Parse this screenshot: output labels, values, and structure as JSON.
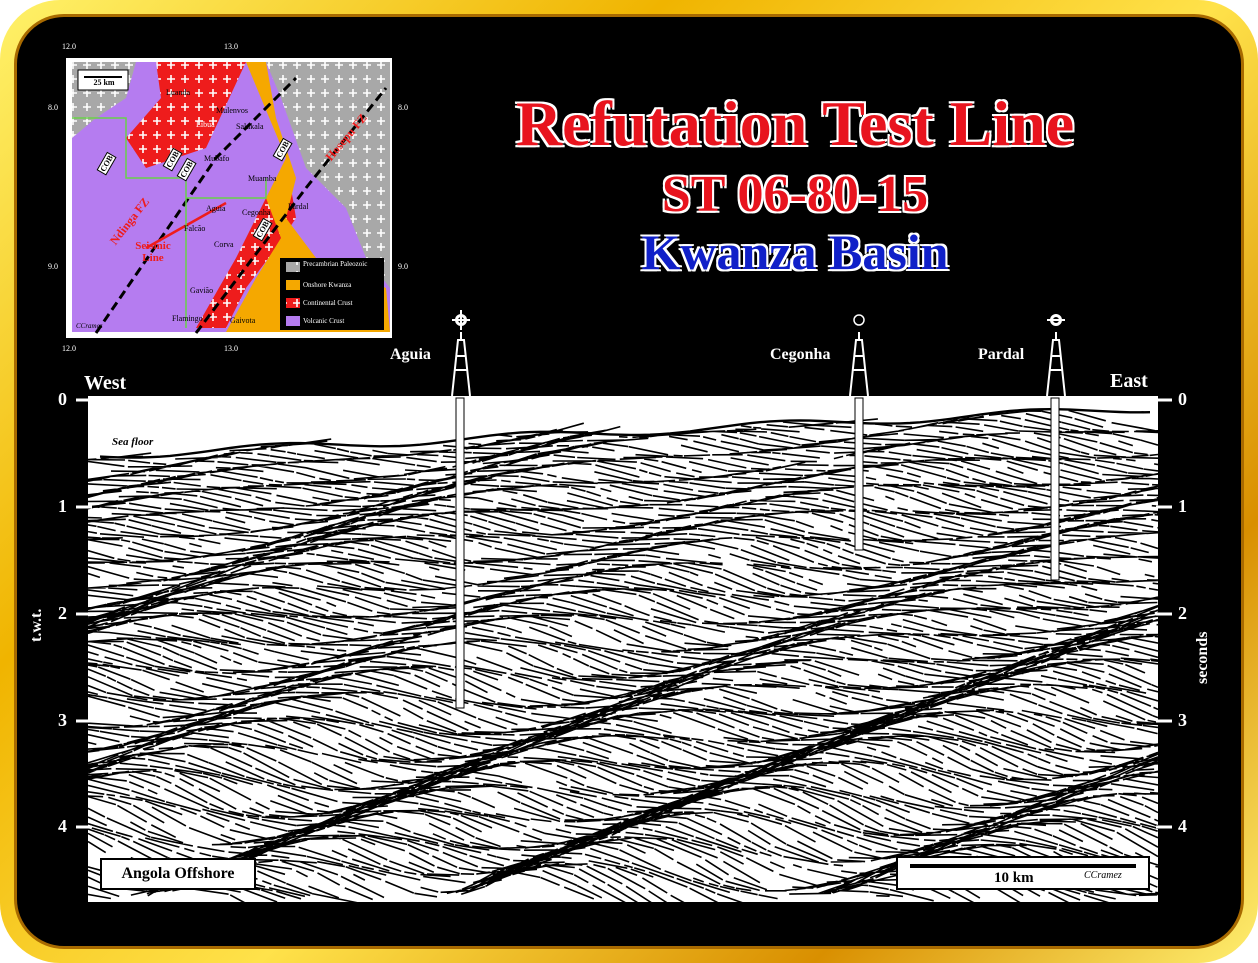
{
  "title": "Refutation Test Line",
  "line_id": "ST 06-80-15",
  "basin": "Kwanza Basin",
  "section": {
    "west": "West",
    "east": "East",
    "sea_floor": "Sea floor",
    "left_axis_label": "t.w.t.",
    "right_axis_label": "seconds",
    "ticks": [
      "0",
      "1",
      "2",
      "3",
      "4"
    ],
    "location_label": "Angola Offshore",
    "scale_label": "10 km",
    "credit": "CCramez"
  },
  "wells": [
    {
      "name": "Aguia"
    },
    {
      "name": "Cegonha"
    },
    {
      "name": "Pardal"
    }
  ],
  "map": {
    "scale": "25 km",
    "lon_ticks": [
      "12.0",
      "13.0"
    ],
    "lat_ticks": [
      "8.0",
      "9.0"
    ],
    "place_names": [
      "Luanda",
      "Mulenvos",
      "Libua",
      "Salukala",
      "Mubafo",
      "Muamba",
      "Aguia",
      "Cegonha",
      "Pardal",
      "Falcão",
      "Corva",
      "Gavião",
      "Flamingo",
      "Gaivota"
    ],
    "cob_label": "COB",
    "fz_left": "Ndinga FZ",
    "fz_right": "Hosepu FZ",
    "seismic_line": "Seismic Line",
    "credit": "CCramez",
    "legend": [
      {
        "label": "Precambrian Paleozoic",
        "color": "#a8a8a8"
      },
      {
        "label": "Onshore Kwanza",
        "color": "#f5a800"
      },
      {
        "label": "Continental Crust",
        "color": "#ee1c1c"
      },
      {
        "label": "Volcanic Crust",
        "color": "#b57cf0"
      }
    ]
  }
}
